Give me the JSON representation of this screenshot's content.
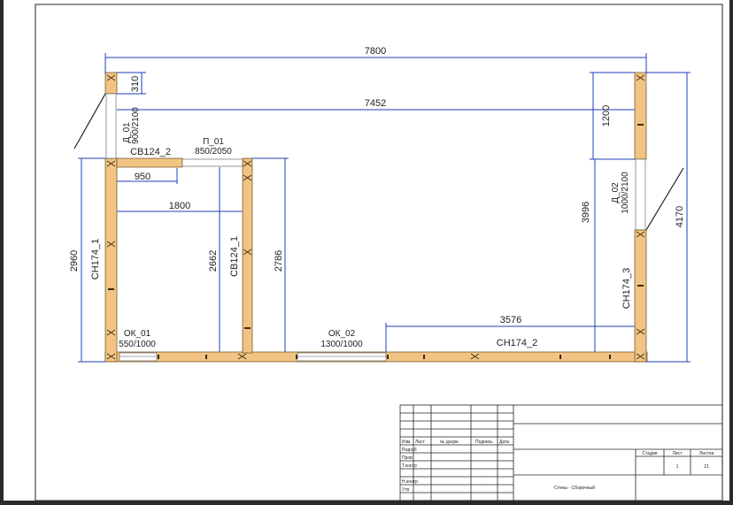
{
  "drawing": {
    "dimensions": {
      "overall_width": "7800",
      "inner_width": "7452",
      "left_top_offset": "310",
      "sb_length": "950",
      "room_width": "1800",
      "left_height": "2960",
      "sb124_1_height": "2662",
      "inner_height": "2786",
      "right_segment": "1200",
      "right_inner_height": "3996",
      "right_height": "4170",
      "bottom_segment": "3576"
    },
    "labels": {
      "d01_name": "Д_01",
      "d01_size": "900/2100",
      "sb124_2": "СВ124_2",
      "p01_name": "П_01",
      "p01_size": "850/2050",
      "sn174_1": "СН174_1",
      "sb124_1": "СВ124_1",
      "ok01_name": "ОК_01",
      "ok01_size": "550/1000",
      "ok02_name": "ОК_02",
      "ok02_size": "1300/1000",
      "sn174_2": "СН174_2",
      "d02_name": "Д_02",
      "d02_size": "1000/2100",
      "sn174_3": "СН174_3"
    },
    "title_block": {
      "headers": [
        "Изм",
        "Лист",
        "№ докум",
        "Подпись",
        "Дата"
      ],
      "roles": [
        "Разраб",
        "Пров",
        "Т.контр",
        "",
        "Н.контр",
        "Утв"
      ],
      "stage_label": "Стадия",
      "sheet_label": "Лист",
      "sheets_label": "Листов",
      "sheet_value": "1",
      "sheets_value": "21",
      "drawing_title": "Стены - Сборочный"
    }
  }
}
